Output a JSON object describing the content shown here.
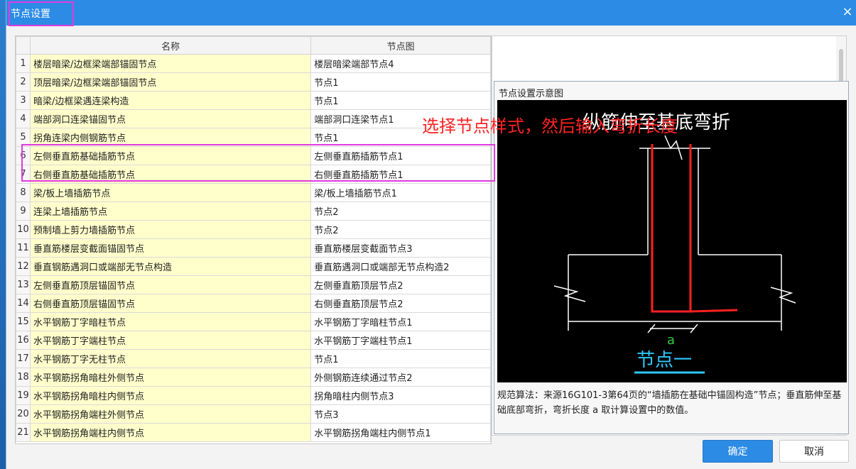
{
  "dialog": {
    "title": "节点设置",
    "close_glyph": "×"
  },
  "table": {
    "headers": [
      "",
      "名称",
      "节点图"
    ],
    "rows": [
      {
        "num": "1",
        "name": "楼层暗梁/边框梁端部锚固节点",
        "node": "楼层暗梁端部节点4"
      },
      {
        "num": "2",
        "name": "顶层暗梁/边框梁端部锚固节点",
        "node": "节点1"
      },
      {
        "num": "3",
        "name": "暗梁/边框梁遇连梁构造",
        "node": "节点1"
      },
      {
        "num": "4",
        "name": "端部洞口连梁锚固节点",
        "node": "端部洞口连梁节点1"
      },
      {
        "num": "5",
        "name": "拐角连梁内侧钢筋节点",
        "node": "节点1"
      },
      {
        "num": "6",
        "name": "左侧垂直筋基础插筋节点",
        "node": "左侧垂直筋插筋节点1"
      },
      {
        "num": "7",
        "name": "右侧垂直筋基础插筋节点",
        "node": "右侧垂直筋插筋节点1"
      },
      {
        "num": "8",
        "name": "梁/板上墙插筋节点",
        "node": "梁/板上墙插筋节点1"
      },
      {
        "num": "9",
        "name": "连梁上墙插筋节点",
        "node": "节点2"
      },
      {
        "num": "10",
        "name": "预制墙上剪力墙插筋节点",
        "node": "节点2"
      },
      {
        "num": "11",
        "name": "垂直筋楼层变截面锚固节点",
        "node": "垂直筋楼层变截面节点3"
      },
      {
        "num": "12",
        "name": "垂直钢筋遇洞口或端部无节点构造",
        "node": "垂直筋遇洞口或端部无节点构造2"
      },
      {
        "num": "13",
        "name": "左侧垂直筋顶层锚固节点",
        "node": "左侧垂直筋顶层节点2"
      },
      {
        "num": "14",
        "name": "右侧垂直筋顶层锚固节点",
        "node": "右侧垂直筋顶层节点2"
      },
      {
        "num": "15",
        "name": "水平钢筋丁字暗柱节点",
        "node": "水平钢筋丁字暗柱节点1"
      },
      {
        "num": "16",
        "name": "水平钢筋丁字端柱节点",
        "node": "水平钢筋丁字端柱节点1"
      },
      {
        "num": "17",
        "name": "水平钢筋丁字无柱节点",
        "node": "节点1"
      },
      {
        "num": "18",
        "name": "水平钢筋拐角暗柱外侧节点",
        "node": "外侧钢筋连续通过节点2"
      },
      {
        "num": "19",
        "name": "水平钢筋拐角暗柱内侧节点",
        "node": "拐角暗柱内侧节点3"
      },
      {
        "num": "20",
        "name": "水平钢筋拐角端柱外侧节点",
        "node": "节点3"
      },
      {
        "num": "21",
        "name": "水平钢筋拐角端柱内侧节点",
        "node": "水平钢筋拐角端柱内侧节点1"
      }
    ]
  },
  "diagram": {
    "panel_title": "节点设置示意图",
    "heading": "纵筋伸至基底弯折",
    "dimension_label": "a",
    "caption": "节点一",
    "description": "规范算法：来源16G101-3第64页的“墙插筋在基础中锚固构造”节点；垂直筋伸至基础底部弯折，弯折长度 a 取计算设置中的数值。",
    "colors": {
      "background": "#000000",
      "rebar": "#ff2020",
      "lines": "#ffffff",
      "dim_text": "#2ecc40",
      "caption": "#2ec8ff"
    }
  },
  "annotation": {
    "note": "选择节点样式，然后输入弯折长度"
  },
  "buttons": {
    "ok": "确定",
    "cancel": "取消"
  }
}
